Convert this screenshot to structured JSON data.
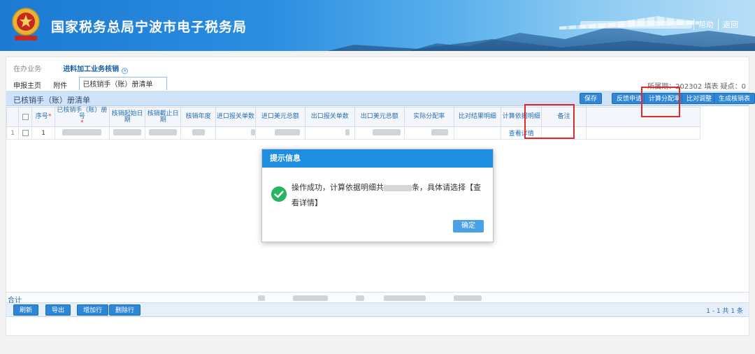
{
  "header": {
    "title": "国家税务总局宁波市电子税务局",
    "links": [
      "帮助",
      "返回"
    ]
  },
  "top_tabs": [
    {
      "label": "在办业务",
      "active": false
    },
    {
      "label": "进料加工业务核销",
      "active": true
    }
  ],
  "sub_tabs": [
    "申报主页",
    "附件",
    "已核销手（账）册清单"
  ],
  "period_info": "所属期：202302  填表  疑点：0",
  "grid": {
    "title": "已核销手（账）册清单",
    "toolbar": [
      "保存",
      "反馈申请",
      "计算分配率",
      "比对调整",
      "生成核销表"
    ],
    "columns": [
      "序号",
      "已核销手（账）册号",
      "核销起始日期",
      "核销截止日期",
      "核销年度",
      "进口报关单数",
      "进口美元总额",
      "出口报关单数",
      "出口美元总额",
      "实际分配率",
      "比对结果明细",
      "计算依据明细",
      "备注"
    ],
    "rows": [
      {
        "row_no": "1",
        "seq": "1",
        "detail_link": "查看详情"
      }
    ],
    "sum_label": "合计",
    "bottom_buttons": [
      "刷新",
      "导出",
      "增加行",
      "删除行"
    ],
    "pager": "1 - 1  共 1 条"
  },
  "dialog": {
    "title": "提示信息",
    "message_before": "操作成功，计算依据明细共",
    "message_after": "条，具体请选择【查看详情】",
    "ok_label": "确定"
  },
  "colors": {
    "header_blue": "#1c7ad2",
    "button_blue": "#2e86d6",
    "dialog_head": "#1e8ee0",
    "success_green": "#28b463",
    "highlight_red": "#e02a2a"
  }
}
